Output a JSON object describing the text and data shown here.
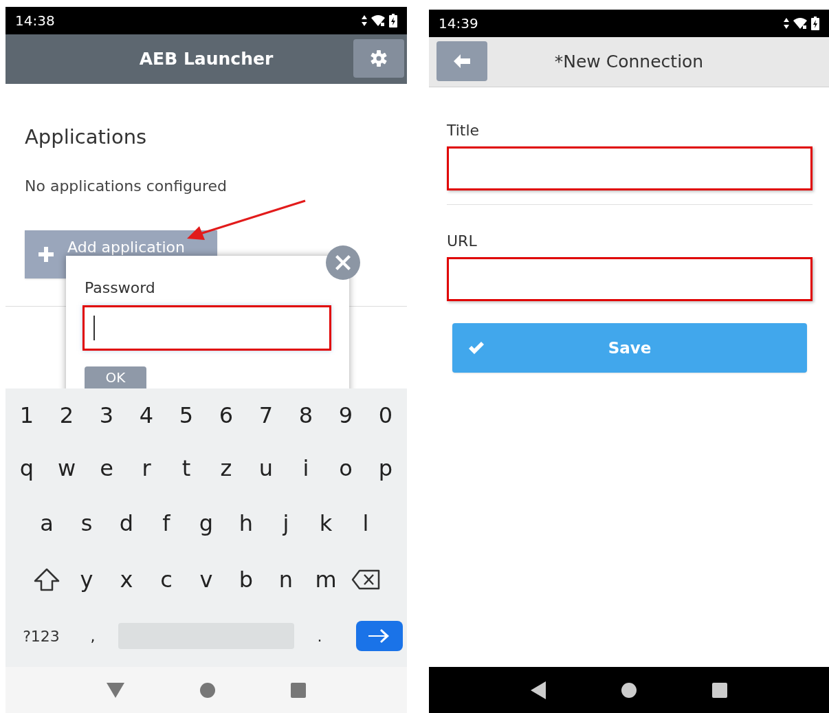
{
  "left_screen": {
    "status_bar": {
      "time": "14:38"
    },
    "header": {
      "title": "AEB Launcher"
    },
    "section_title": "Applications",
    "empty_message": "No applications configured",
    "add_button": {
      "label": "Add application"
    },
    "dialog": {
      "label": "Password",
      "ok_button": "OK"
    },
    "keyboard": {
      "rows": [
        [
          "1",
          "2",
          "3",
          "4",
          "5",
          "6",
          "7",
          "8",
          "9",
          "0"
        ],
        [
          "q",
          "w",
          "e",
          "r",
          "t",
          "z",
          "u",
          "i",
          "o",
          "p"
        ],
        [
          "a",
          "s",
          "d",
          "f",
          "g",
          "h",
          "j",
          "k",
          "l"
        ],
        [
          {
            "kind": "shift"
          },
          "y",
          "x",
          "c",
          "v",
          "b",
          "n",
          "m",
          {
            "kind": "backspace"
          }
        ],
        [
          "?123",
          ",",
          {
            "kind": "space"
          },
          ".",
          {
            "kind": "enter"
          }
        ]
      ]
    }
  },
  "right_screen": {
    "status_bar": {
      "time": "14:39"
    },
    "header": {
      "title": "*New Connection"
    },
    "fields": [
      {
        "label": "Title"
      },
      {
        "label": "URL"
      }
    ],
    "save_button": {
      "label": "Save"
    }
  }
}
